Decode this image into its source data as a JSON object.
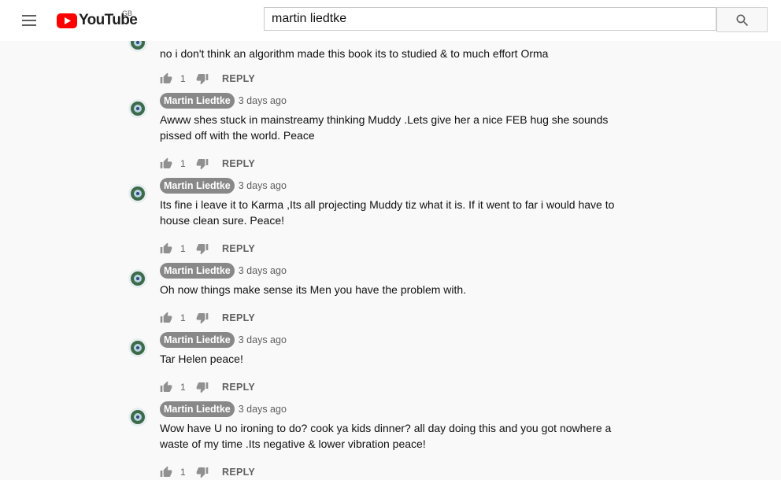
{
  "app": {
    "logo_text": "YouTube",
    "region": "GB",
    "brand_red": "#ff0000"
  },
  "search": {
    "query": "martin liedtke",
    "icon": "search-icon"
  },
  "reply_label": "REPLY",
  "comments": [
    {
      "author": "",
      "time": "",
      "text": "no i don't think an algorithm made this book its to studied & to much effort Orma",
      "likes": "1"
    },
    {
      "author": "Martin Liedtke",
      "time": "3 days ago",
      "text": "Awww shes stuck in mainstreamy thinking Muddy .Lets give her a nice FEB hug she sounds pissed off with the world. Peace",
      "likes": "1"
    },
    {
      "author": "Martin Liedtke",
      "time": "3 days ago",
      "text": "Its fine i leave it to Karma ,Its all projecting Muddy tiz what it is. If it went to far i would have to house clean sure. Peace!",
      "likes": "1"
    },
    {
      "author": "Martin Liedtke",
      "time": "3 days ago",
      "text": "Oh now things make sense its Men you have the problem with.",
      "likes": "1"
    },
    {
      "author": "Martin Liedtke",
      "time": "3 days ago",
      "text": "Tar Helen peace!",
      "likes": "1"
    },
    {
      "author": "Martin Liedtke",
      "time": "3 days ago",
      "text": "Wow have U no ironing to do? cook ya kids dinner? all day doing this and you got nowhere a waste of my time .Its negative & lower vibration peace!",
      "likes": "1"
    }
  ]
}
